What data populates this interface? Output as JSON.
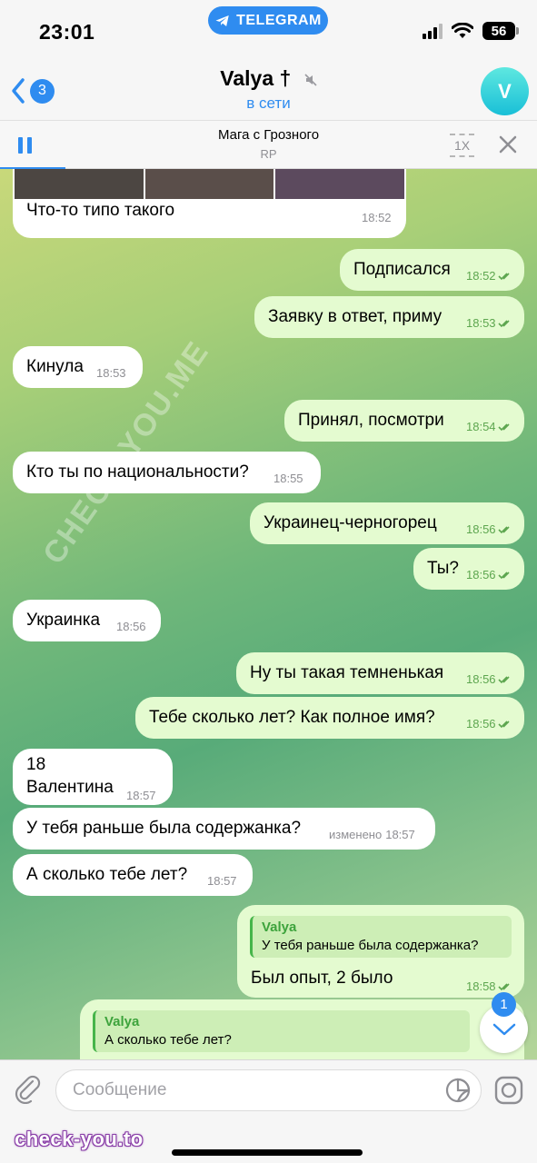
{
  "status": {
    "time": "23:01",
    "badge": "TELEGRAM",
    "battery": "56"
  },
  "header": {
    "back_count": "3",
    "title": "Valya †",
    "subtitle": "в сети",
    "avatar_letter": "V"
  },
  "player": {
    "track": "Мага с Грозного",
    "artist": "RP",
    "speed": "1X"
  },
  "messages": [
    {
      "dir": "in",
      "text": "Что-то типо такого",
      "time": "18:52"
    },
    {
      "dir": "out",
      "text": "Подписался",
      "time": "18:52"
    },
    {
      "dir": "out",
      "text": "Заявку в ответ, приму",
      "time": "18:53"
    },
    {
      "dir": "in",
      "text": "Кинула",
      "time": "18:53"
    },
    {
      "dir": "out",
      "text": "Принял, посмотри",
      "time": "18:54"
    },
    {
      "dir": "in",
      "text": "Кто ты по национальности?",
      "time": "18:55"
    },
    {
      "dir": "out",
      "text": "Украинец-черногорец",
      "time": "18:56"
    },
    {
      "dir": "out",
      "text": "Ты?",
      "time": "18:56"
    },
    {
      "dir": "in",
      "text": "Украинка",
      "time": "18:56"
    },
    {
      "dir": "out",
      "text": "Ну ты такая темненькая",
      "time": "18:56"
    },
    {
      "dir": "out",
      "text": "Тебе сколько лет? Как полное имя?",
      "time": "18:56"
    },
    {
      "dir": "in",
      "text_line1": "18",
      "text_line2": "Валентина",
      "time": "18:57"
    },
    {
      "dir": "in",
      "text": "У тебя раньше была содержанка?",
      "edited": "изменено",
      "time": "18:57"
    },
    {
      "dir": "in",
      "text": "А сколько тебе лет?",
      "time": "18:57"
    },
    {
      "dir": "out",
      "reply_name": "Valya",
      "reply_text": "У тебя раньше была содержанка?",
      "text": "Был опыт, 2 было",
      "time": "18:58"
    },
    {
      "dir": "out",
      "reply_name": "Valya",
      "reply_text": "А сколько тебе лет?"
    }
  ],
  "scroll_badge": "1",
  "composer": {
    "placeholder": "Сообщение"
  },
  "watermark": {
    "site": "check-you.to",
    "text": "CHECK-YOU.ME"
  },
  "colors": {
    "accent": "#2f8cf0",
    "outgoing": "#e4fbd0",
    "incoming": "#ffffff",
    "check": "#5da64f"
  }
}
